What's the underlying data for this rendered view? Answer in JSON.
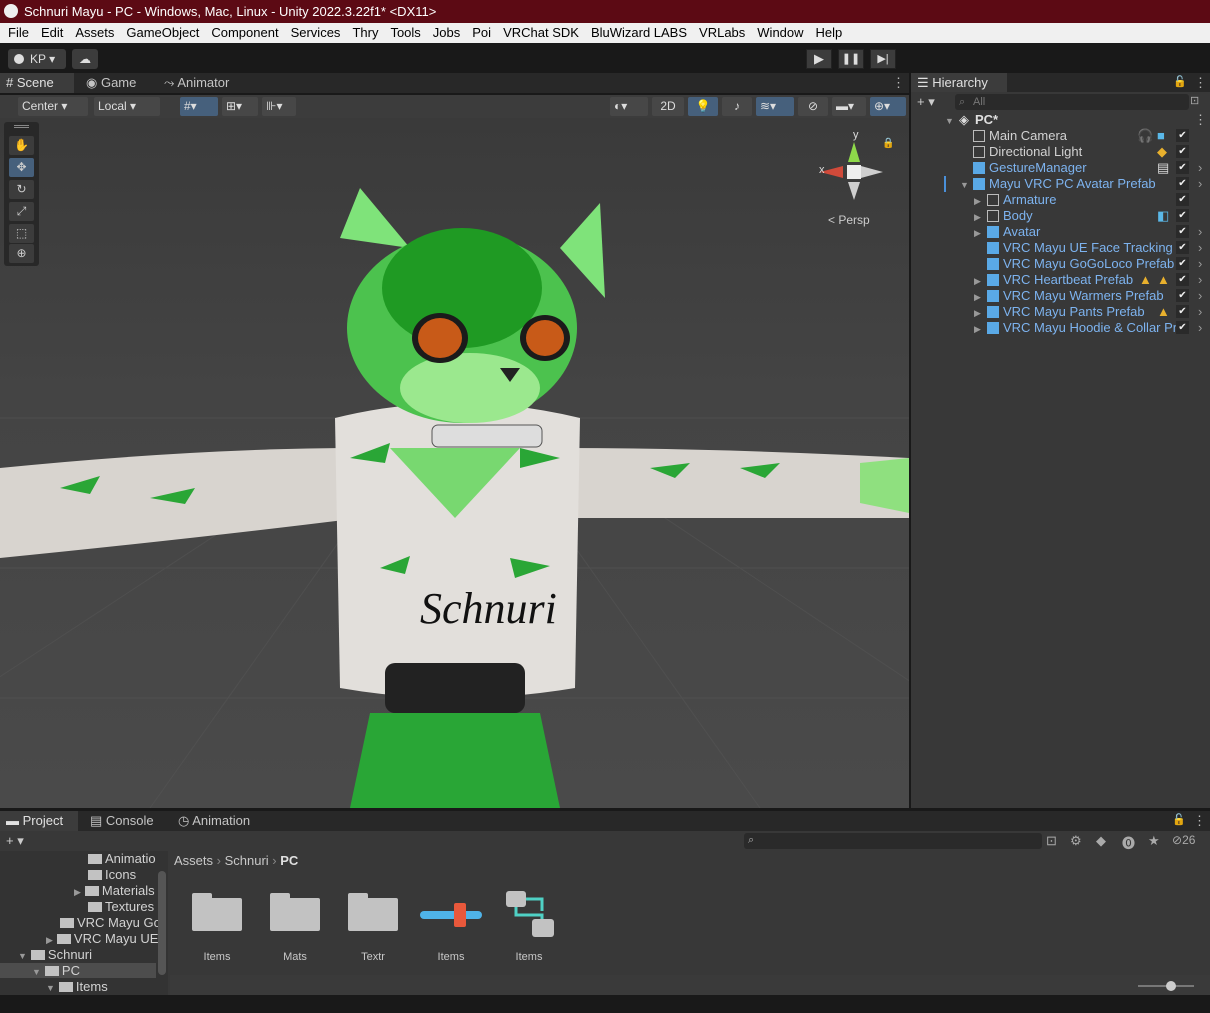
{
  "window": {
    "title": "Schnuri Mayu - PC - Windows, Mac, Linux - Unity 2022.3.22f1* <DX11>"
  },
  "menu": [
    "File",
    "Edit",
    "Assets",
    "GameObject",
    "Component",
    "Services",
    "Thry",
    "Tools",
    "Jobs",
    "Poi",
    "VRChat SDK",
    "BluWizard LABS",
    "VRLabs",
    "Window",
    "Help"
  ],
  "toolbar": {
    "account": "KP"
  },
  "scene_tabs": [
    "Scene",
    "Game",
    "Animator"
  ],
  "scene_toolbar": {
    "pivot": "Center",
    "space": "Local",
    "mode_2d": "2D"
  },
  "gizmo": {
    "y_label": "y",
    "x_label": "x",
    "projection": "Persp"
  },
  "avatar_text": "Schnuri",
  "hierarchy": {
    "title": "Hierarchy",
    "search_placeholder": "All",
    "scene": "PC*",
    "items": [
      {
        "label": "Main Camera"
      },
      {
        "label": "Directional Light"
      },
      {
        "label": "GestureManager"
      },
      {
        "label": "Mayu VRC PC Avatar Prefab"
      },
      {
        "label": "Armature"
      },
      {
        "label": "Body"
      },
      {
        "label": "Avatar"
      },
      {
        "label": "VRC Mayu UE Face Tracking"
      },
      {
        "label": "VRC Mayu GoGoLoco Prefab"
      },
      {
        "label": "VRC Heartbeat Prefab"
      },
      {
        "label": "VRC Mayu Warmers Prefab"
      },
      {
        "label": "VRC Mayu Pants Prefab"
      },
      {
        "label": "VRC Mayu Hoodie & Collar Pr"
      }
    ]
  },
  "bottom_tabs": [
    "Project",
    "Console",
    "Animation"
  ],
  "project": {
    "hidden_count": "26",
    "breadcrumb": [
      "Assets",
      "Schnuri",
      "PC"
    ],
    "tree": [
      "Animatio",
      "Icons",
      "Materials",
      "Textures",
      "VRC Mayu Go",
      "VRC Mayu UE",
      "Schnuri",
      "PC",
      "Items"
    ],
    "assets": [
      "Items",
      "Mats",
      "Textr",
      "Items",
      "Items"
    ]
  }
}
